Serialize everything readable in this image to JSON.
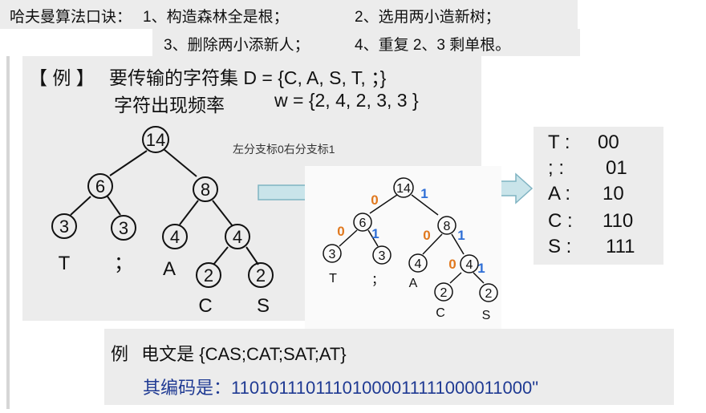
{
  "rules": {
    "title": "哈夫曼算法口诀：",
    "r1": "1、构造森林全是根；",
    "r2": "2、选用两小造新树；",
    "r3": "3、删除两小添新人；",
    "r4": "4、重复 2、3 剩单根。"
  },
  "example": {
    "bracket": "【 例 】",
    "charset": "要传输的字符集 D = {C, A, S, T, ；}",
    "freq_label": "字符出现频率",
    "freq": "w = {2, 4, 2, 3, 3 }"
  },
  "caption": "左分支标0右分支标1",
  "tree_left": {
    "nodes": [
      "14",
      "6",
      "8",
      "3",
      "3",
      "4",
      "4",
      "2",
      "2"
    ],
    "leaf_labels": [
      "T",
      "；",
      "A",
      "C",
      "S"
    ]
  },
  "tree_right": {
    "nodes": [
      "14",
      "6",
      "8",
      "3",
      "3",
      "4",
      "4",
      "2",
      "2"
    ],
    "leaf_labels": [
      "T",
      "；",
      "A",
      "C",
      "S"
    ],
    "edge_labels": [
      "0",
      "1",
      "0",
      "1",
      "0",
      "1",
      "0",
      "1"
    ]
  },
  "codes": [
    {
      "sym": "T :",
      "val": "00"
    },
    {
      "sym": "; :",
      "val": "01"
    },
    {
      "sym": "A :",
      "val": "10"
    },
    {
      "sym": "C :",
      "val": "110"
    },
    {
      "sym": "S :",
      "val": "111"
    }
  ],
  "message": {
    "prefix": "例",
    "text": "电文是 {CAS;CAT;SAT;AT}",
    "code_label": "其编码是：",
    "code": "11010111011101000011111000011000\""
  },
  "colors": {
    "zero": "#e0781e",
    "one": "#2f6fd6",
    "arrow_fill": "#c9e4ea",
    "arrow_stroke": "#7fb3c2"
  }
}
